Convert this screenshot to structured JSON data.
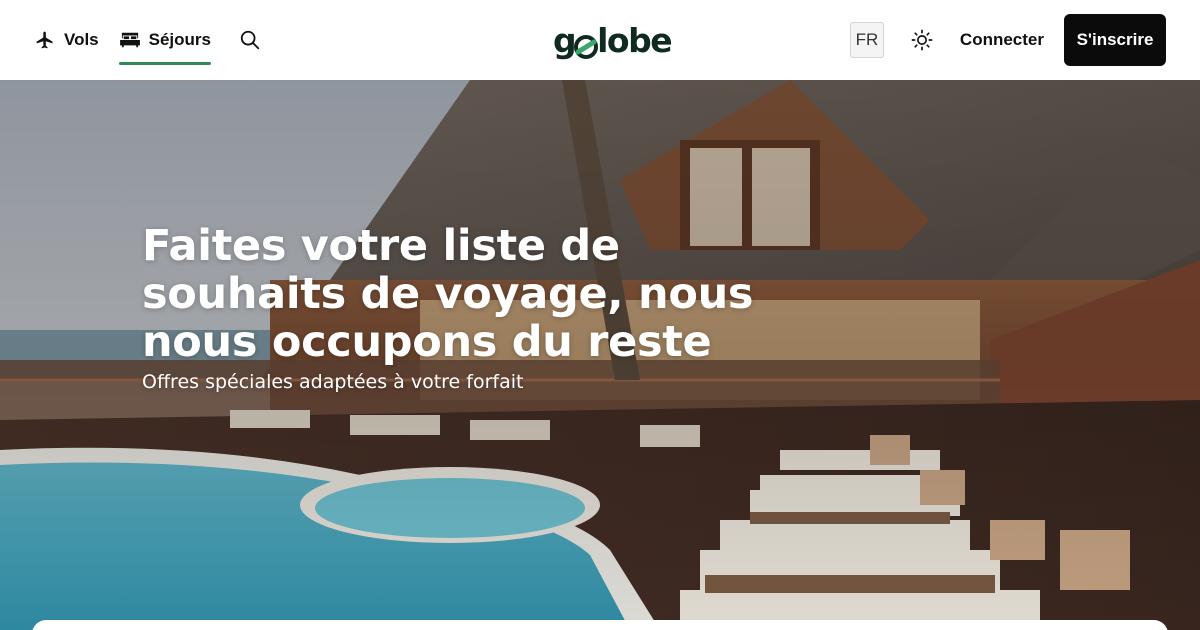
{
  "header": {
    "tabs": [
      {
        "label": "Vols",
        "icon": "plane-icon",
        "active": false
      },
      {
        "label": "Séjours",
        "icon": "bed-icon",
        "active": true
      }
    ],
    "search_icon": "search-icon",
    "logo_text_left": "g",
    "logo_text_right": "lobe",
    "language": "FR",
    "theme_icon": "sun-icon",
    "login_label": "Connecter",
    "signup_label": "S'inscrire",
    "accent_color": "#2e8b57"
  },
  "hero": {
    "title": "Faites votre liste de souhaits de voyage, nous nous occupons du reste",
    "subtitle": "Offres spéciales adaptées à votre forfait"
  }
}
